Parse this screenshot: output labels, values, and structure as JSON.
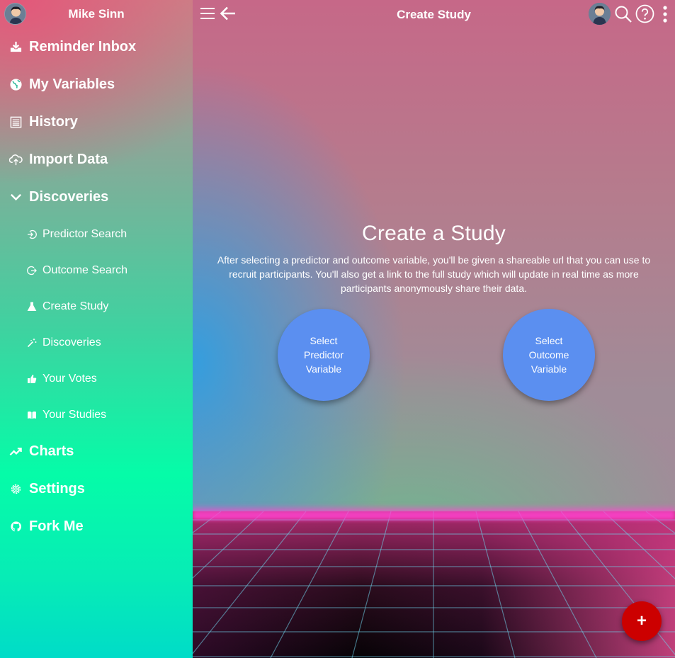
{
  "sidebar": {
    "user_name": "Mike Sinn",
    "items": [
      {
        "label": "Reminder Inbox",
        "icon": "inbox-download-icon"
      },
      {
        "label": "My Variables",
        "icon": "globe-icon"
      },
      {
        "label": "History",
        "icon": "list-icon"
      },
      {
        "label": "Import Data",
        "icon": "cloud-upload-icon"
      },
      {
        "label": "Discoveries",
        "icon": "chevron-down-icon"
      }
    ],
    "sub_items": [
      {
        "label": "Predictor Search",
        "icon": "sign-in-icon"
      },
      {
        "label": "Outcome Search",
        "icon": "sign-out-icon"
      },
      {
        "label": "Create Study",
        "icon": "flask-icon"
      },
      {
        "label": "Discoveries",
        "icon": "magic-wand-icon"
      },
      {
        "label": "Your Votes",
        "icon": "thumbs-up-icon"
      },
      {
        "label": "Your Studies",
        "icon": "book-icon"
      }
    ],
    "bottom_items": [
      {
        "label": "Charts",
        "icon": "trending-up-icon"
      },
      {
        "label": "Settings",
        "icon": "gear-icon"
      },
      {
        "label": "Fork Me",
        "icon": "github-icon"
      }
    ]
  },
  "header": {
    "title": "Create Study"
  },
  "main": {
    "heading": "Create a Study",
    "description": "After selecting a predictor and outcome variable, you'll be given a shareable url that you can use to recruit participants. You'll also get a link to the full study which will update in real time as more participants anonymously share their data.",
    "predictor_button": "Select Predictor Variable",
    "outcome_button": "Select Outcome Variable",
    "fab_label": "+"
  },
  "colors": {
    "circle_button": "#5b8ff0",
    "fab": "#cc0000",
    "grid_line": "#6fd0e8",
    "floor_glow": "#ff46d2"
  }
}
